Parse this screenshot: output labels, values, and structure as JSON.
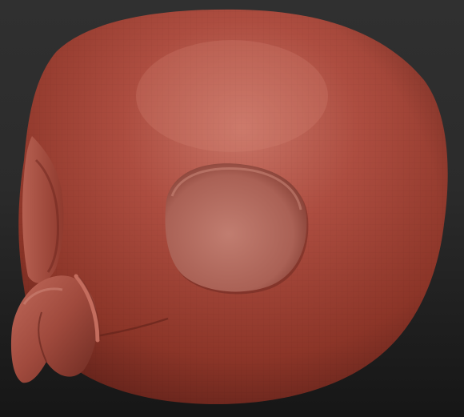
{
  "scene": {
    "subject": "sculpted-bird-head",
    "colors": {
      "background_top": "#303030",
      "background_bottom": "#161616",
      "clay_base": "#a8483a",
      "clay_light": "#c8705f",
      "clay_dark": "#5a1f19",
      "eye_socket": "#b36b5f",
      "beak": "#a95445"
    }
  }
}
